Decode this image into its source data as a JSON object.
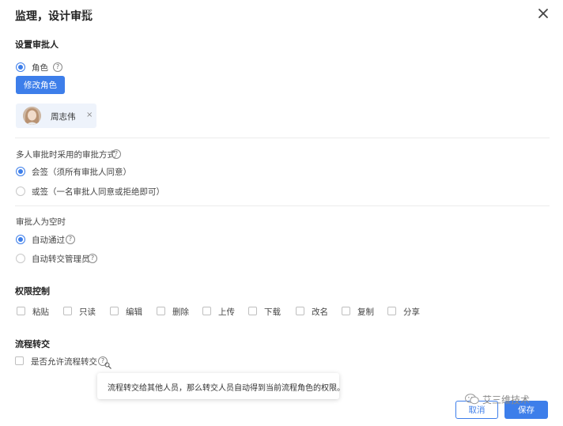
{
  "dialog": {
    "title": "监理，设计审批"
  },
  "approver": {
    "section_title": "设置审批人",
    "role_option": "角色",
    "modify_button": "修改角色",
    "user_name": "周志伟",
    "user_remove": "×"
  },
  "multi": {
    "title": "多人审批时采用的审批方式",
    "options": [
      "会签（须所有审批人同意）",
      "或签（一名审批人同意或拒绝即可）"
    ],
    "selected": 0
  },
  "empty": {
    "title": "审批人为空时",
    "options": [
      "自动通过",
      "自动转交管理员"
    ],
    "selected": 0
  },
  "permissions": {
    "title": "权限控制",
    "items": [
      "粘贴",
      "只读",
      "编辑",
      "删除",
      "上传",
      "下载",
      "改名",
      "复制",
      "分享"
    ]
  },
  "transfer": {
    "title": "流程转交",
    "allow_label": "是否允许流程转交",
    "tooltip": "流程转交给其他人员，那么转交人员自动得到当前流程角色的权限。"
  },
  "footer": {
    "cancel_label": "取消",
    "save_label": "保存"
  },
  "watermark": {
    "text": "艾三维技术"
  },
  "colors": {
    "accent": "#3d7eea"
  }
}
